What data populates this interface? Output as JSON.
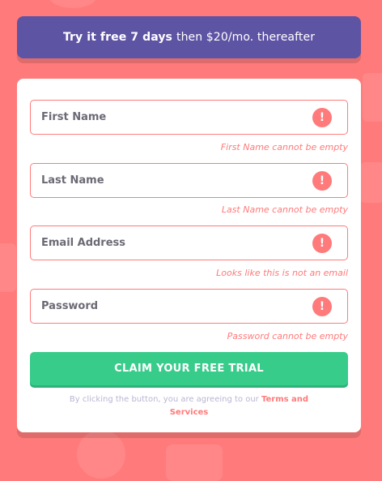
{
  "banner": {
    "bold_text": "Try it free 7 days",
    "rest_text": "then $20/mo. thereafter"
  },
  "form": {
    "fields": [
      {
        "placeholder": "First Name",
        "value": "",
        "error": "First Name cannot be empty",
        "icon": "exclamation-icon"
      },
      {
        "placeholder": "Last Name",
        "value": "",
        "error": "Last Name cannot be empty",
        "icon": "exclamation-icon"
      },
      {
        "placeholder": "Email Address",
        "value": "",
        "error": "Looks like this is not an email",
        "icon": "exclamation-icon"
      },
      {
        "placeholder": "Password",
        "value": "",
        "error": "Password cannot be empty",
        "icon": "exclamation-icon"
      }
    ],
    "submit_label": "CLAIM YOUR FREE TRIAL",
    "terms_prefix": "By clicking the button, you are agreeing to our",
    "terms_link": "Terms and Services",
    "error_glyph": "!"
  },
  "colors": {
    "background": "#ff7a7a",
    "banner": "#5e54a4",
    "accent_green": "#38cc8b",
    "error_red": "#ff7a7a",
    "muted_text": "#b9b6d3"
  }
}
